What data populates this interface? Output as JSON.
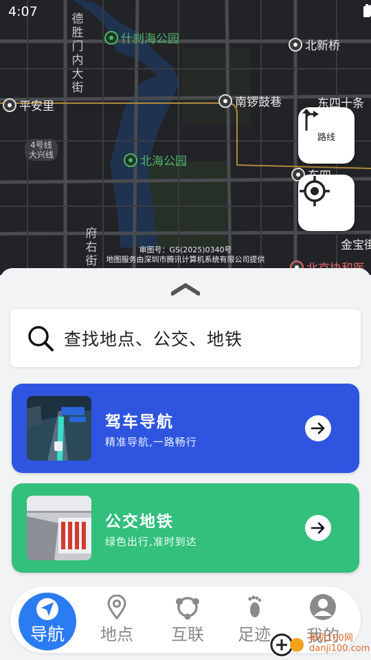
{
  "status": {
    "time": "4:07"
  },
  "map": {
    "pois": [
      {
        "name": "什刹海公园",
        "kind": "park"
      },
      {
        "name": "北新桥",
        "kind": "metro"
      },
      {
        "name": "平安里",
        "kind": "metro"
      },
      {
        "name": "南锣鼓巷",
        "kind": "metro"
      },
      {
        "name": "东四十条",
        "kind": "plain"
      },
      {
        "name": "北海公园",
        "kind": "park"
      },
      {
        "name": "东四",
        "kind": "metro"
      },
      {
        "name": "金宝街",
        "kind": "plain"
      },
      {
        "name": "北京协和医",
        "kind": "hospital"
      }
    ],
    "roads": {
      "deshengmen": "德胜门内大街",
      "fuyou": "府右街"
    },
    "metro_badge": {
      "line1": "4号线",
      "line2": "大兴线"
    },
    "copyright": {
      "line1": "审图号：GS(2025)0340号",
      "line2": "地图服务由深圳市腾讯计算机系统有限公司提供"
    },
    "route_button": {
      "label": "路线",
      "icon": "route-fork-icon"
    },
    "locate_button": {
      "icon": "crosshair-icon"
    }
  },
  "search": {
    "placeholder": "查找地点、公交、地铁",
    "icon": "search-icon"
  },
  "cards": [
    {
      "title": "驾车导航",
      "subtitle": "精准导航,一路畅行",
      "color": "#2f55e0"
    },
    {
      "title": "公交地铁",
      "subtitle": "绿色出行,准时到达",
      "color": "#33bf7c"
    }
  ],
  "tabbar": [
    {
      "label": "导航",
      "icon": "navigation-arrow-icon",
      "active": true
    },
    {
      "label": "地点",
      "icon": "location-pin-icon"
    },
    {
      "label": "互联",
      "icon": "link-circle-icon"
    },
    {
      "label": "足迹",
      "icon": "footprint-icon"
    },
    {
      "label": "我的",
      "icon": "user-icon"
    }
  ],
  "watermark": {
    "name": "单机100网",
    "domain": "danji100.com"
  },
  "colors": {
    "accent": "#2b7cf3",
    "drive_card": "#2f55e0",
    "transit_card": "#33bf7c"
  }
}
